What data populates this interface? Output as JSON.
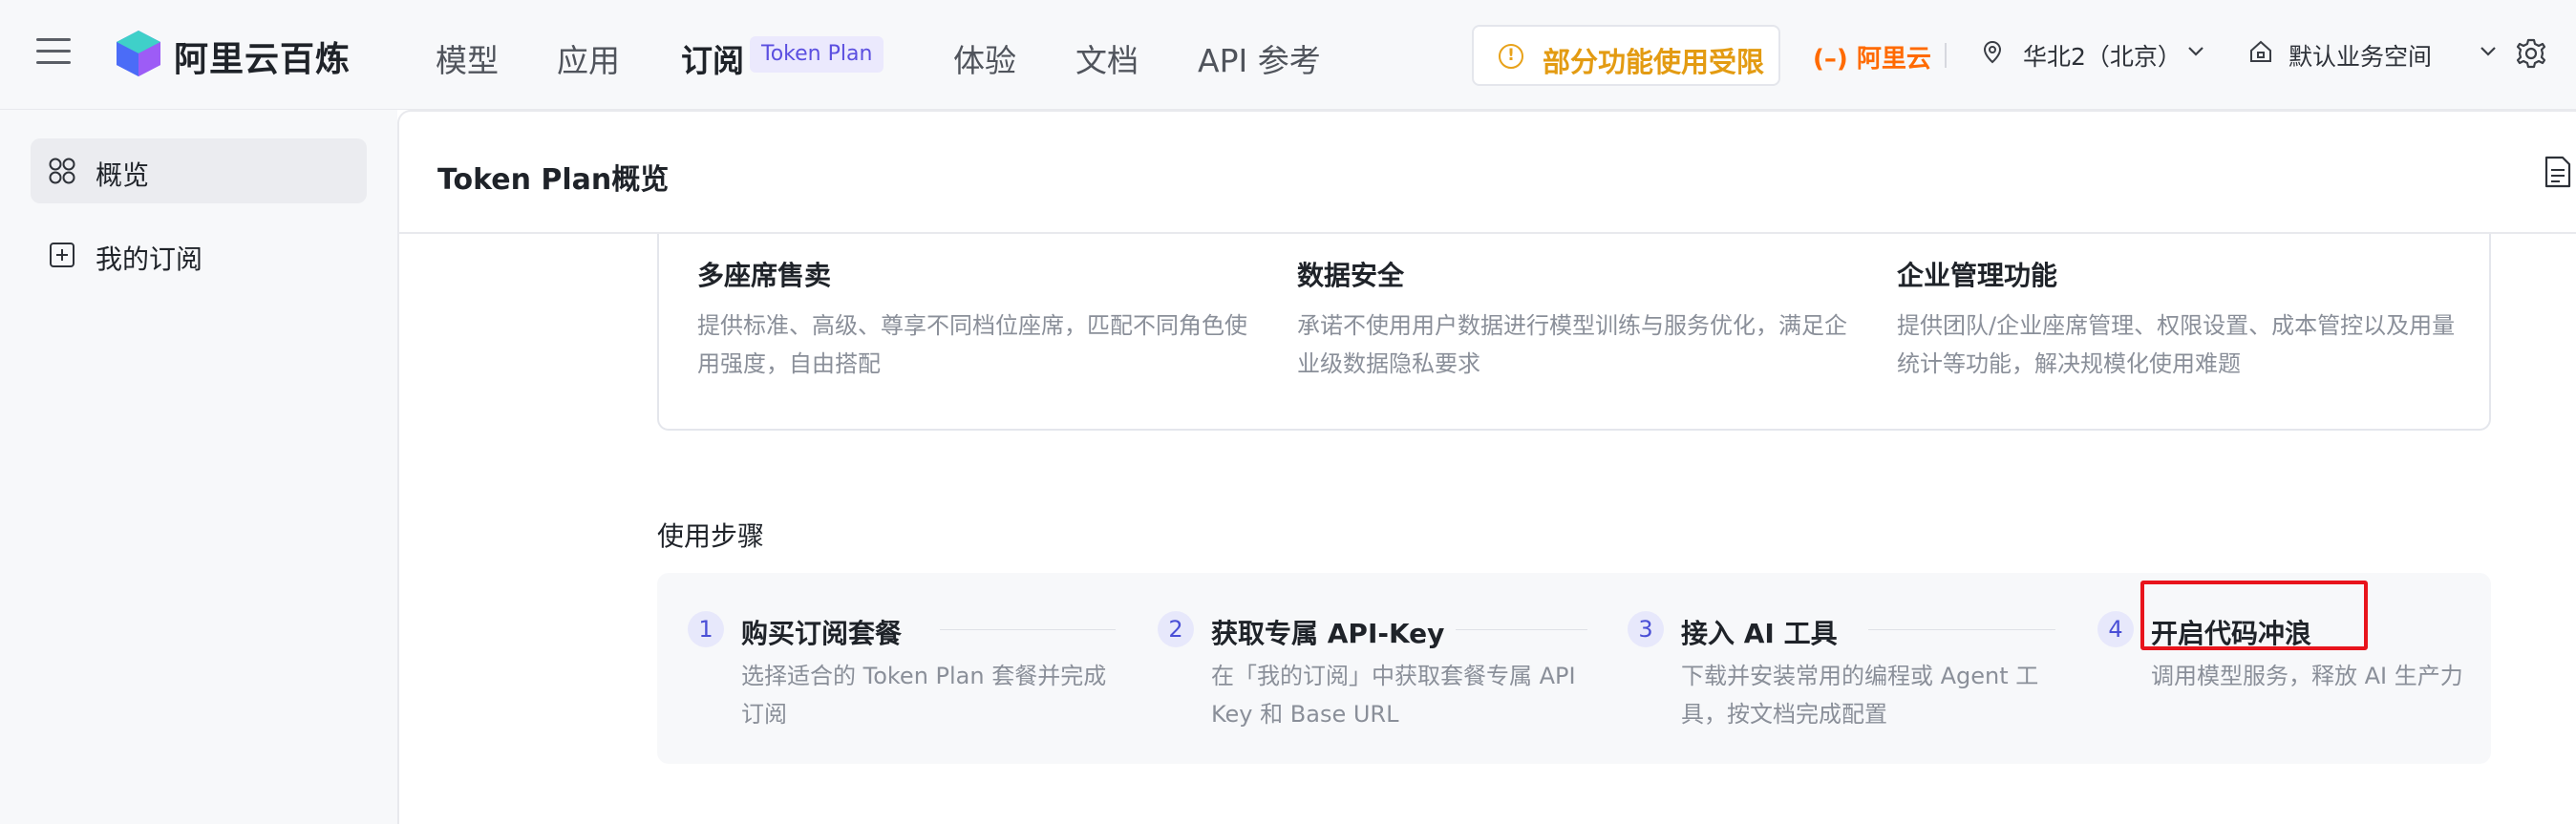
{
  "header": {
    "brand": "阿里云百炼",
    "nav": [
      {
        "label": "模型"
      },
      {
        "label": "应用"
      },
      {
        "label": "订阅"
      },
      {
        "label": "体验"
      },
      {
        "label": "文档"
      },
      {
        "label": "API 参考"
      }
    ],
    "nav_badge": "Token Plan",
    "warning": "部分功能使用受限",
    "aliyun_logo": "阿里云",
    "region": "华北2（北京）",
    "workspace": "默认业务空间"
  },
  "sidebar": {
    "items": [
      {
        "label": "概览",
        "icon": "grid-icon",
        "active": true
      },
      {
        "label": "我的订阅",
        "icon": "plus-square-icon",
        "active": false
      }
    ]
  },
  "main": {
    "title": "Token Plan概览",
    "features": [
      {
        "title": "多座席售卖",
        "desc": "提供标准、高级、尊享不同档位座席，匹配不同角色使用强度，自由搭配"
      },
      {
        "title": "数据安全",
        "desc": "承诺不使用用户数据进行模型训练与服务优化，满足企业级数据隐私要求"
      },
      {
        "title": "企业管理功能",
        "desc": "提供团队/企业座席管理、权限设置、成本管控以及用量统计等功能，解决规模化使用难题"
      }
    ],
    "steps_title": "使用步骤",
    "steps": [
      {
        "num": "1",
        "title": "购买订阅套餐",
        "desc": "选择适合的 Token Plan 套餐并完成订阅"
      },
      {
        "num": "2",
        "title": "获取专属 API-Key",
        "desc": "在「我的订阅」中获取套餐专属 API Key 和 Base URL"
      },
      {
        "num": "3",
        "title": "接入 AI 工具",
        "desc": "下载并安装常用的编程或 Agent 工具，按文档完成配置"
      },
      {
        "num": "4",
        "title": "开启代码冲浪",
        "desc": "调用模型服务，释放 AI 生产力"
      }
    ]
  },
  "colors": {
    "accent": "#4a4fd6",
    "warning": "#e39b12",
    "aliyun": "#ff6a00",
    "highlight": "#e8141c"
  }
}
